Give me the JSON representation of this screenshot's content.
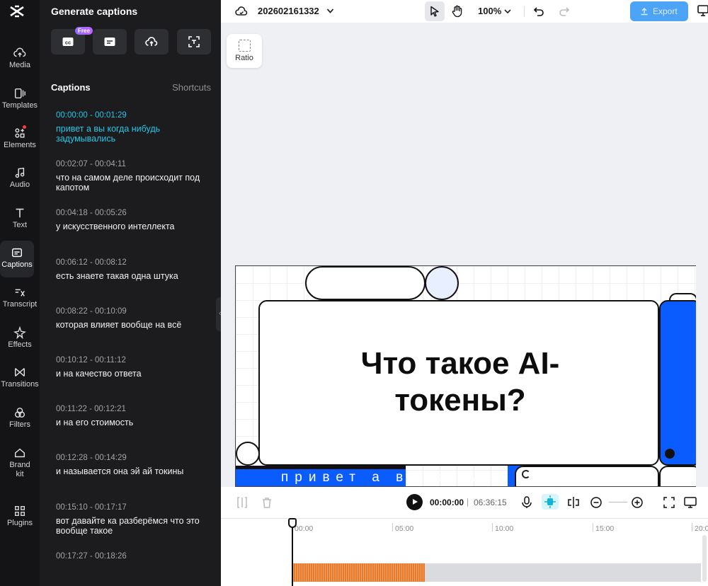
{
  "rail": {
    "items": [
      {
        "label": "Media",
        "icon": "cloud-upload-icon"
      },
      {
        "label": "Templates",
        "icon": "templates-icon"
      },
      {
        "label": "Elements",
        "icon": "elements-icon"
      },
      {
        "label": "Audio",
        "icon": "music-note-icon"
      },
      {
        "label": "Text",
        "icon": "text-icon"
      },
      {
        "label": "Captions",
        "icon": "captions-icon"
      },
      {
        "label": "Transcript",
        "icon": "transcript-icon"
      },
      {
        "label": "Effects",
        "icon": "sparkle-icon"
      },
      {
        "label": "Transitions",
        "icon": "transitions-icon"
      },
      {
        "label": "Filters",
        "icon": "filters-icon"
      },
      {
        "label": "Brand kit",
        "icon": "brand-kit-icon"
      },
      {
        "label": "Plugins",
        "icon": "plugins-icon"
      }
    ],
    "active": "Captions"
  },
  "panel": {
    "title": "Generate captions",
    "free_badge": "Free",
    "captions_heading": "Captions",
    "shortcuts_label": "Shortcuts",
    "captions": [
      {
        "time": "00:00:00 - 00:01:29",
        "text": "привет а вы когда нибудь задумывались",
        "active": true
      },
      {
        "time": "00:02:07 - 00:04:11",
        "text": "что на самом деле происходит под капотом"
      },
      {
        "time": "00:04:18 - 00:05:26",
        "text": "у искусственного интеллекта"
      },
      {
        "time": "00:06:12 - 00:08:12",
        "text": "есть знаете такая одна штука"
      },
      {
        "time": "00:08:22 - 00:10:09",
        "text": "которая влияет вообще на всё"
      },
      {
        "time": "00:10:12 - 00:11:12",
        "text": "и на качество ответа"
      },
      {
        "time": "00:11:22 - 00:12:21",
        "text": "и на его стоимость"
      },
      {
        "time": "00:12:28 - 00:14:29",
        "text": "и называется она эй ай токины"
      },
      {
        "time": "00:15:10 - 00:17:17",
        "text": "вот давайте ка разберёмся что это вообще такое"
      },
      {
        "time": "00:17:27 - 00:18:26",
        "text": ""
      }
    ]
  },
  "topbar": {
    "project_name": "202602161332",
    "zoom": "100%",
    "export_label": "Export"
  },
  "canvas": {
    "ratio_label": "Ratio",
    "headline": "Что такое AI-\nтокены?",
    "subtitle_strip": "привет а вы когда"
  },
  "timeline": {
    "current_time": "00:00:00",
    "separator": "|",
    "total_time": "06:36:15",
    "ruler": [
      "00:00",
      "05:00",
      "10:00",
      "15:00",
      "20:0"
    ]
  }
}
